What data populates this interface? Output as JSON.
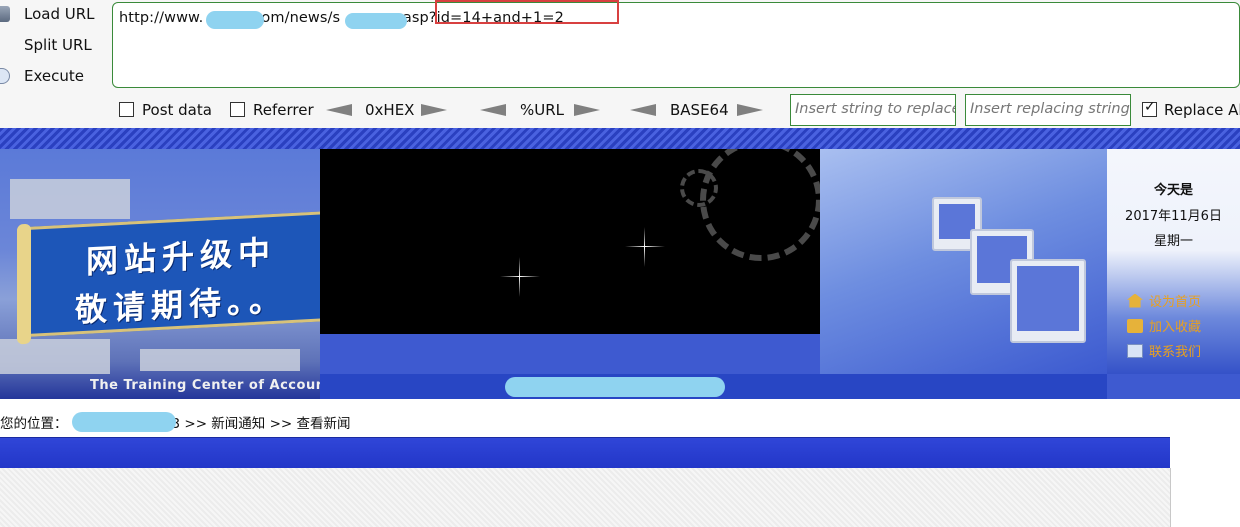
{
  "hackbar": {
    "buttons": {
      "load_url": "Load URL",
      "split_url": "Split URL",
      "execute": "Execute"
    },
    "url": {
      "part1": "http://www.",
      "part2": "om/news/s",
      "part3": ".asp?id=14+and+1=2"
    },
    "options": {
      "post_data": "Post data",
      "referrer": "Referrer",
      "hex": "0xHEX",
      "url_enc": "%URL",
      "base64": "BASE64",
      "replace_placeholder": "Insert string to replace",
      "replacing_placeholder": "Insert replacing string",
      "replace_all": "Replace All",
      "replace_all_checked": true
    }
  },
  "site": {
    "sign": {
      "line1": "网站升级中",
      "line2": "敬请期待。。"
    },
    "banner_caption": "The Training Center of Accounting",
    "date_panel": {
      "label": "今天是",
      "date": "2017年11月6日",
      "weekday": "星期一"
    },
    "quick_links": {
      "set_home": "设为首页",
      "add_favorite": "加入收藏",
      "contact": "联系我们"
    },
    "breadcrumb": {
      "prefix": "您的位置：",
      "tail": "3 >> 新闻通知 >> 查看新闻"
    }
  },
  "colors": {
    "banner_blue": "#3e5ad0",
    "url_border": "#3a8a3a",
    "highlight_red": "#d84040"
  }
}
